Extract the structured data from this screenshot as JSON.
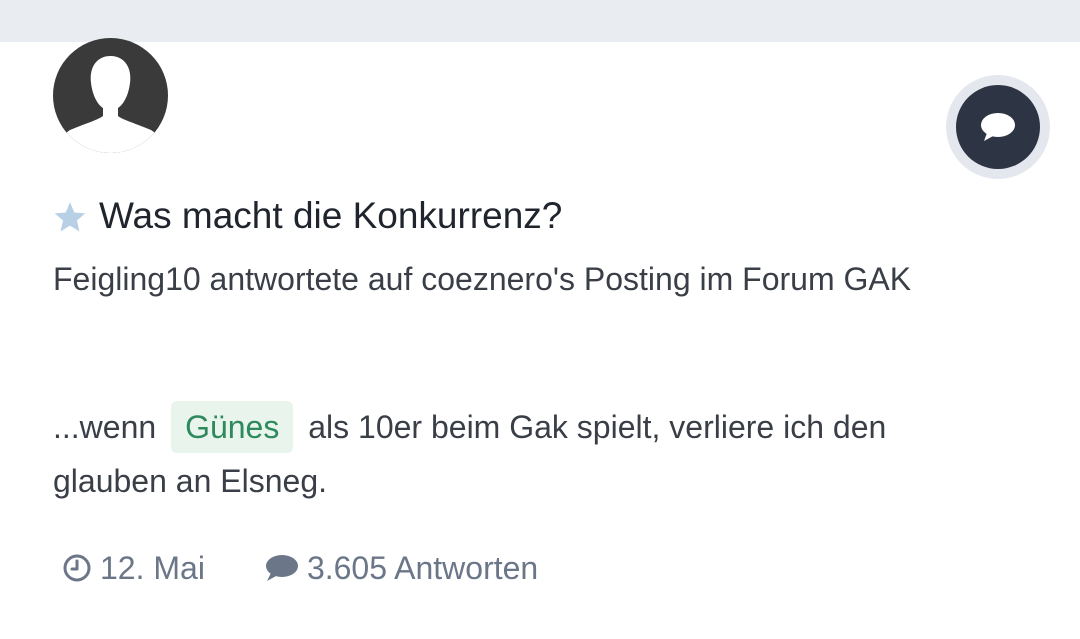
{
  "post": {
    "title": "Was macht die Konkurrenz?",
    "meta": "Feigling10 antwortete auf coeznero's Posting im Forum GAK",
    "excerpt_before": "...wenn",
    "excerpt_tag": "Günes",
    "excerpt_after": "als 10er beim Gak spielt, verliere ich den glauben an Elsneg.",
    "date": "12. Mai",
    "replies": "3.605 Antworten"
  },
  "icons": {
    "avatar": "default-user-silhouette",
    "reply": "speech-bubble-icon",
    "favorite": "star-icon",
    "date": "clock-icon",
    "replies": "comment-icon"
  },
  "colors": {
    "top_bar": "#e9ecf1",
    "reply_button": "#2d3443",
    "star": "#b8d0e6",
    "tag_bg": "#e8f4ec",
    "tag_text": "#2e8a5c",
    "footer_text": "#6b7688"
  }
}
